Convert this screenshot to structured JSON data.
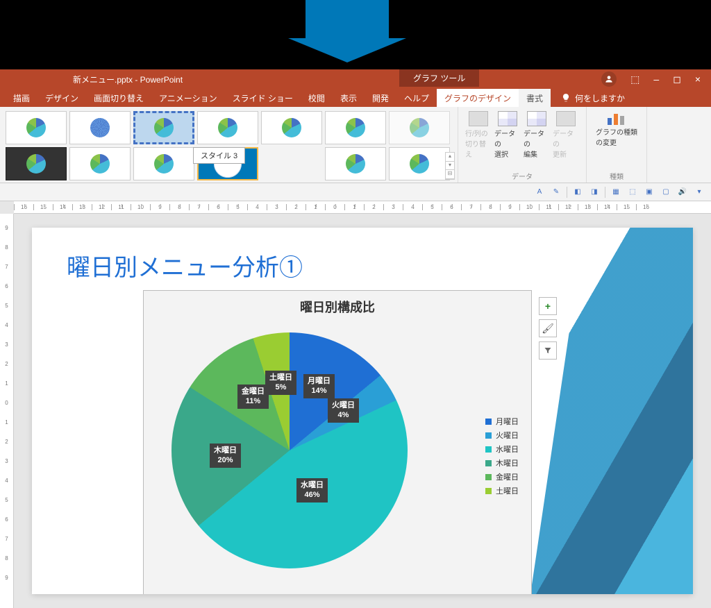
{
  "titlebar": {
    "filename": "新メニュー.pptx - PowerPoint",
    "tool_context": "グラフ ツール"
  },
  "window_controls": {
    "minimize": "–",
    "maximize": "◻",
    "close": "×",
    "ribbon_opts": "⬚"
  },
  "ribbon": {
    "tabs": [
      "描画",
      "デザイン",
      "画面切り替え",
      "アニメーション",
      "スライド ショー",
      "校閲",
      "表示",
      "開発",
      "ヘルプ"
    ],
    "active_tab": "グラフのデザイン",
    "sub_tab": "書式",
    "tell_me": "何をしますか"
  },
  "style_gallery": {
    "tooltip": "スタイル 3"
  },
  "data_group": {
    "label": "データ",
    "switch": "行/列の\n切り替え",
    "select": "データの\n選択",
    "edit": "データの\n編集",
    "refresh": "データの\n更新"
  },
  "type_group": {
    "label": "種類",
    "change": "グラフの種類\nの変更"
  },
  "ruler_h": [
    "16",
    "15",
    "14",
    "13",
    "12",
    "11",
    "10",
    "9",
    "8",
    "7",
    "6",
    "5",
    "4",
    "3",
    "2",
    "1",
    "0",
    "1",
    "2",
    "3",
    "4",
    "5",
    "6",
    "7",
    "8",
    "9",
    "10",
    "11",
    "12",
    "13",
    "14",
    "15",
    "16"
  ],
  "ruler_v": [
    "9",
    "8",
    "7",
    "6",
    "5",
    "4",
    "3",
    "2",
    "1",
    "0",
    "1",
    "2",
    "3",
    "4",
    "5",
    "6",
    "7",
    "8",
    "9"
  ],
  "slide": {
    "title": "曜日別メニュー分析①",
    "side_tools": {
      "plus": "+",
      "brush": "🖌",
      "filter": "▾"
    }
  },
  "chart_data": {
    "type": "pie",
    "title": "曜日別構成比",
    "categories": [
      "月曜日",
      "火曜日",
      "水曜日",
      "木曜日",
      "金曜日",
      "土曜日"
    ],
    "values": [
      14,
      4,
      46,
      20,
      11,
      5
    ],
    "labels": [
      {
        "name": "月曜日",
        "pct": "14%"
      },
      {
        "name": "火曜日",
        "pct": "4%"
      },
      {
        "name": "水曜日",
        "pct": "46%"
      },
      {
        "name": "木曜日",
        "pct": "20%"
      },
      {
        "name": "金曜日",
        "pct": "11%"
      },
      {
        "name": "土曜日",
        "pct": "5%"
      }
    ],
    "colors": [
      "#1f6fd4",
      "#2a9fd6",
      "#1fc4c4",
      "#3aa88a",
      "#5cb85c",
      "#9acd32"
    ],
    "legend": [
      "月曜日",
      "火曜日",
      "水曜日",
      "木曜日",
      "金曜日",
      "土曜日"
    ]
  }
}
